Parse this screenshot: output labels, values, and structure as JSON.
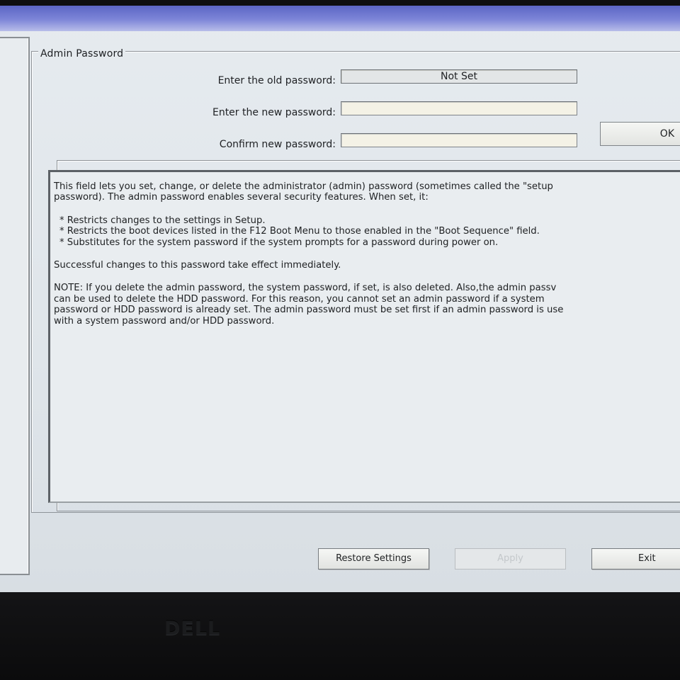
{
  "section": {
    "title": "Admin Password"
  },
  "fields": {
    "old_label": "Enter the old password:",
    "old_value": "Not Set",
    "new_label": "Enter the new password:",
    "new_value": "",
    "confirm_label": "Confirm new password:",
    "confirm_value": ""
  },
  "ok_label": "OK",
  "description": {
    "line1": "This field lets you set, change, or delete the administrator (admin) password (sometimes called the \"setup",
    "line2": "password). The admin password enables several security features. When set, it:",
    "bullets": [
      "* Restricts changes to the settings in Setup.",
      "* Restricts the boot devices listed in the F12 Boot Menu to those enabled in the \"Boot Sequence\" field.",
      "* Substitutes for the system password if the system prompts for a password during power on."
    ],
    "success": "Successful changes to this password take effect immediately.",
    "note_lines": [
      "NOTE: If you delete the admin password, the system password, if set, is also deleted. Also,the admin passv",
      "can be used to delete the HDD password.  For this reason, you cannot set an admin password if a system",
      "password or HDD password is already set. The admin password must be set first if an admin password is use",
      "with a system password and/or HDD password."
    ]
  },
  "buttons": {
    "restore": "Restore Settings",
    "apply": "Apply",
    "exit": "Exit"
  },
  "monitor": {
    "logo": "DELL"
  }
}
